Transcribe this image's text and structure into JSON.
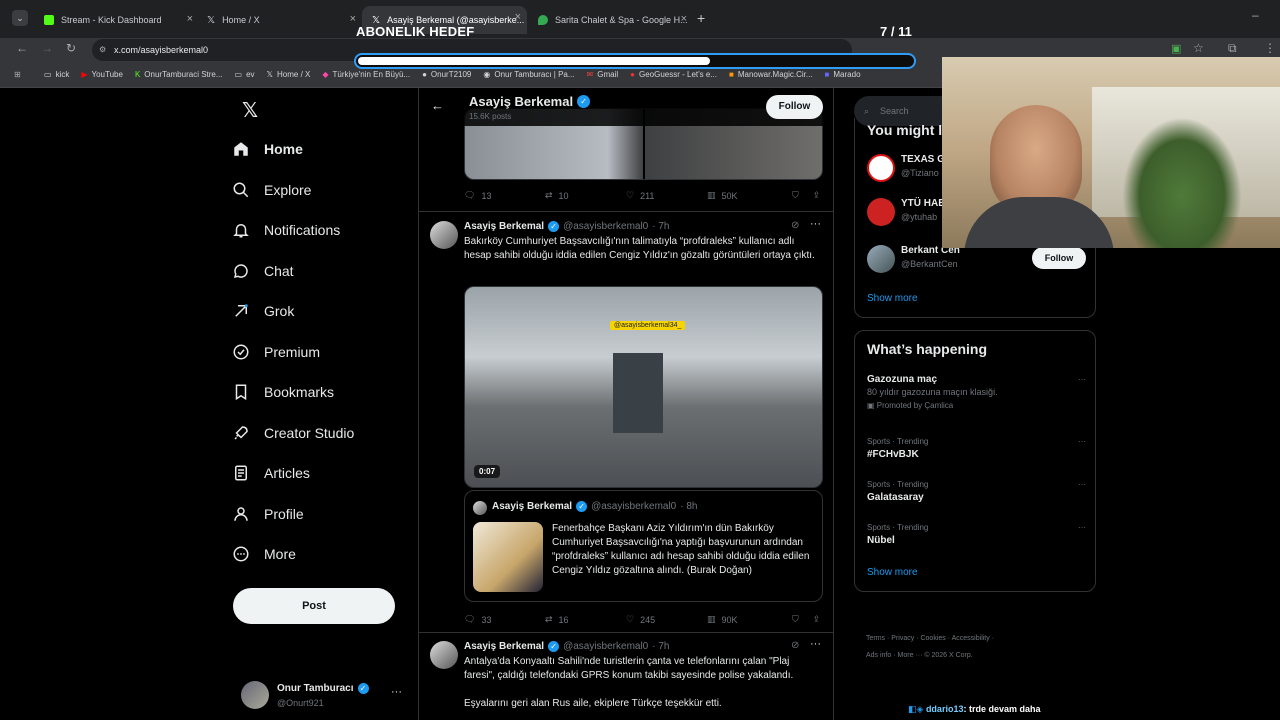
{
  "browser": {
    "tabs": [
      {
        "label": "Stream - Kick Dashboard",
        "icon": "kick-icon",
        "color": "#53fc18"
      },
      {
        "label": "Home / X",
        "icon": "x-logo-icon",
        "color": "#ffffff"
      },
      {
        "label": "Asayiş Berkemal (@asayisberke...",
        "icon": "x-logo-icon",
        "color": "#ffffff"
      },
      {
        "label": "Sarita Chalet & Spa - Google H...",
        "icon": "maps-pin-icon",
        "color": "#34a853"
      }
    ],
    "url": "x.com/asayisberkemal0",
    "bookmarks": [
      "kick",
      "YouTube",
      "OnurTamburaci Stre...",
      "ev",
      "Home / X",
      "Türkiye'nin En Büyü...",
      "OnurT2109",
      "Onur Tamburacı | Pa...",
      "Gmail",
      "GeoGuessr - Let's e...",
      "Manowar.Magic.Cir...",
      "Marado"
    ]
  },
  "overlay": {
    "title": "ABONELIK HEDEF",
    "count": "7 / 11",
    "progress": 0.636
  },
  "nav": {
    "items": [
      {
        "label": "Home",
        "icon": "home-icon"
      },
      {
        "label": "Explore",
        "icon": "search-icon"
      },
      {
        "label": "Notifications",
        "icon": "bell-icon"
      },
      {
        "label": "Chat",
        "icon": "chat-icon"
      },
      {
        "label": "Grok",
        "icon": "grok-icon"
      },
      {
        "label": "Premium",
        "icon": "premium-icon"
      },
      {
        "label": "Bookmarks",
        "icon": "bookmark-icon"
      },
      {
        "label": "Creator Studio",
        "icon": "rocket-icon"
      },
      {
        "label": "Articles",
        "icon": "articles-icon"
      },
      {
        "label": "Profile",
        "icon": "profile-icon"
      },
      {
        "label": "More",
        "icon": "more-icon"
      }
    ],
    "post_label": "Post",
    "account": {
      "name": "Onur Tamburacı",
      "handle": "@Onurt921"
    }
  },
  "profile_header": {
    "name": "Asayiş Berkemal",
    "posts": "15.6K posts",
    "follow_label": "Follow"
  },
  "tweets": [
    {
      "replies": "13",
      "retweets": "10",
      "likes": "211",
      "views": "50K"
    },
    {
      "name": "Asayiş Berkemal",
      "handle": "@asayisberkemal0",
      "time": "· 7h",
      "text": "Bakırköy Cumhuriyet Başsavcılığı'nın talimatıyla “profdraleks” kullanıcı adlı hesap sahibi olduğu iddia edilen Cengiz Yıldız'ın gözaltı görüntüleri ortaya çıktı.",
      "video_watermark": "@asayisberkemal34_",
      "video_duration": "0:07",
      "quote": {
        "name": "Asayiş Berkemal",
        "handle": "@asayisberkemal0",
        "time": "· 8h",
        "text": "Fenerbahçe Başkanı Aziz Yıldırım'ın dün Bakırköy Cumhuriyet Başsavcılığı'na yaptığı başvurunun ardından “profdraleks” kullanıcı adı hesap sahibi olduğu iddia edilen Cengiz Yıldız gözaltına alındı. (Burak Doğan)"
      },
      "replies": "33",
      "retweets": "16",
      "likes": "245",
      "views": "90K"
    },
    {
      "name": "Asayiş Berkemal",
      "handle": "@asayisberkemal0",
      "time": "· 7h",
      "text": "Antalya'da Konyaaltı Sahili'nde turistlerin çanta ve telefonlarını çalan \"Plaj faresi\", çaldığı telefondaki GPRS konum takibi sayesinde polise yakalandı.",
      "text2": "Eşyalarını geri alan Rus aile, ekiplere Türkçe teşekkür etti."
    }
  ],
  "sidebar": {
    "search_placeholder": "Search",
    "who_to_follow_title": "You might l",
    "suggestions": [
      {
        "name": "TEXAS G",
        "handle": "@Tiziano"
      },
      {
        "name": "YTÜ HAB",
        "handle": "@ytuhab"
      },
      {
        "name": "Berkant Cen",
        "handle": "@BerkantCen",
        "follow_label": "Follow"
      }
    ],
    "show_more_1": "Show more",
    "happening_title": "What’s happening",
    "trends": [
      {
        "category": "",
        "title": "Gazozuna maç",
        "subtitle": "80 yıldır gazozuna maçın klasiği.",
        "promo": "Promoted by Çamlica"
      },
      {
        "category": "Sports · Trending",
        "title": "#FCHvBJK"
      },
      {
        "category": "Sports · Trending",
        "title": "Galatasaray"
      },
      {
        "category": "Sports · Trending",
        "title": "Nübel"
      }
    ],
    "show_more_2": "Show more",
    "footer": [
      "Terms",
      "Privacy",
      "Cookies",
      "Accessibility",
      "Ads info",
      "More ···",
      "© 2026 X Corp."
    ]
  },
  "chat_message": {
    "user": "ddario13",
    "text": ": trde devam daha"
  }
}
